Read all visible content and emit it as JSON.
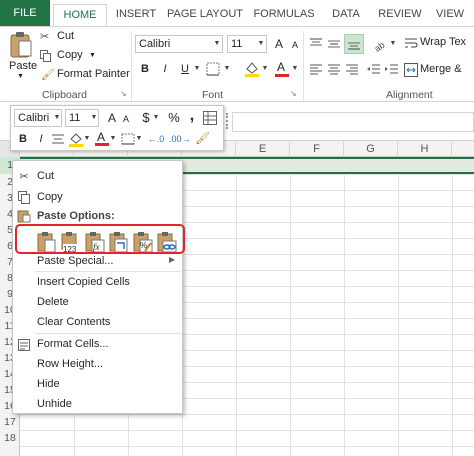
{
  "tabs": [
    "FILE",
    "HOME",
    "INSERT",
    "PAGE LAYOUT",
    "FORMULAS",
    "DATA",
    "REVIEW",
    "VIEW"
  ],
  "clipboard": {
    "paste_label": "Paste",
    "cut_label": "Cut",
    "copy_label": "Copy",
    "format_painter_label": "Format Painter",
    "group_label": "Clipboard"
  },
  "font": {
    "font_name": "Calibri",
    "font_size": "11",
    "group_label": "Font",
    "bold": "B",
    "italic": "I",
    "underline": "U",
    "grow": "A",
    "shrink": "A"
  },
  "alignment": {
    "wrap_text_label": "Wrap Tex",
    "merge_label": "Merge &",
    "group_label": "Alignment"
  },
  "mini_toolbar": {
    "font_name": "Calibri",
    "font_size": "11",
    "currency": "$",
    "percent": "%",
    "comma": ",",
    "bold": "B",
    "italic": "I"
  },
  "grid": {
    "columns": [
      "",
      "",
      "",
      "",
      "E",
      "F",
      "G",
      "H"
    ],
    "rows": [
      "1",
      "2",
      "3",
      "4",
      "5",
      "6",
      "7",
      "8",
      "9",
      "10",
      "11",
      "12",
      "13",
      "14",
      "15",
      "16",
      "17",
      "18"
    ]
  },
  "context_menu": {
    "cut": "Cut",
    "copy": "Copy",
    "paste_options": "Paste Options:",
    "paste_special": "Paste Special...",
    "insert_copied_cells": "Insert Copied Cells",
    "delete": "Delete",
    "clear_contents": "Clear Contents",
    "format_cells": "Format Cells...",
    "row_height": "Row Height...",
    "hide": "Hide",
    "unhide": "Unhide"
  },
  "paste_icons": [
    "paste-icon",
    "paste-values-icon",
    "paste-formulas-icon",
    "paste-transpose-icon",
    "paste-formatting-icon",
    "paste-link-icon"
  ],
  "paste_icon_labels": {
    "values": "123",
    "formulas": "fx"
  },
  "colors": {
    "accent": "#217346",
    "highlight": "#e3242b",
    "selection": "#e1ecdf"
  }
}
